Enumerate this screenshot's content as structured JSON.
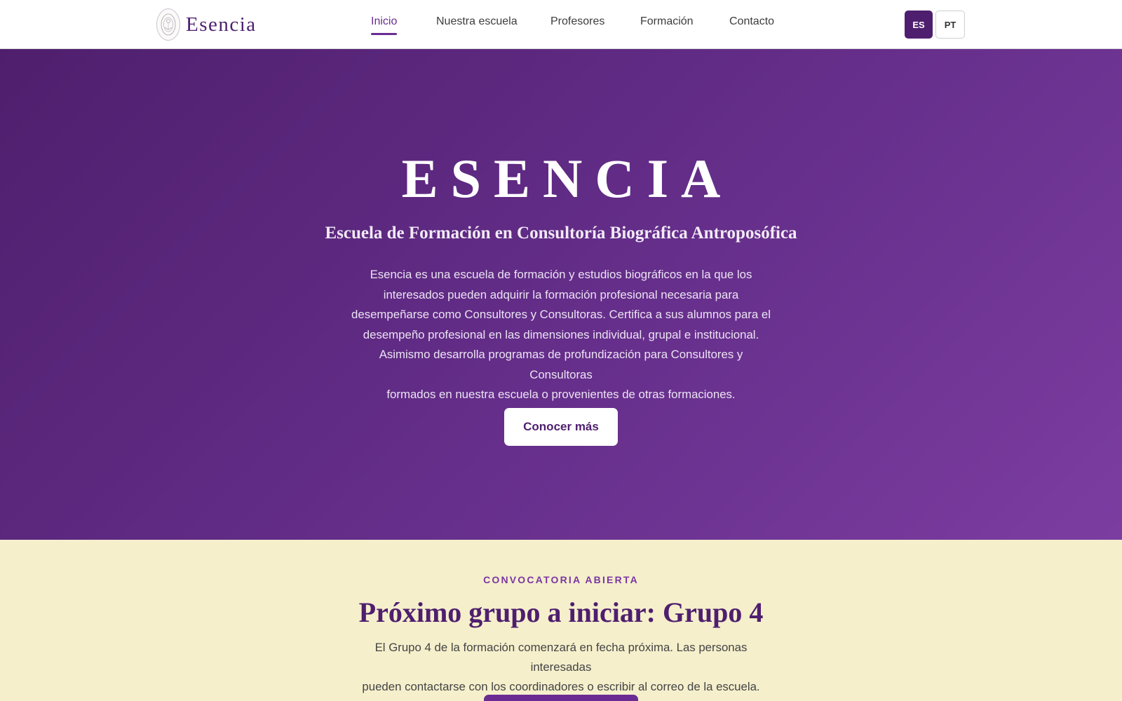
{
  "header": {
    "brand_name": "Esencia",
    "logo_icon": "ornamental-seal-icon",
    "nav": [
      {
        "label": "Inicio",
        "active": true
      },
      {
        "label": "Nuestra escuela",
        "active": false
      },
      {
        "label": "Profesores",
        "active": false
      },
      {
        "label": "Formación",
        "active": false
      },
      {
        "label": "Contacto",
        "active": false
      }
    ],
    "languages": [
      {
        "label": "ES",
        "selected": true
      },
      {
        "label": "PT",
        "selected": false
      }
    ]
  },
  "hero": {
    "title": "ESENCIA",
    "subtitle": "Escuela de Formación en Consultoría Biográfica Antroposófica",
    "description_lines": [
      "Esencia es una escuela de formación y estudios biográficos en la que los",
      "interesados pueden adquirir la formación profesional necesaria para",
      "desempeñarse como Consultores y Consultoras. Certifica a sus alumnos para el",
      "desempeño profesional en las dimensiones individual, grupal e institucional.",
      "Asimismo desarrolla programas de profundización para Consultores y Consultoras",
      "formados en nuestra escuela o provenientes de otras formaciones."
    ],
    "cta_label": "Conocer más"
  },
  "convocatoria": {
    "eyebrow": "CONVOCATORIA ABIERTA",
    "title": "Próximo grupo a iniciar: Grupo 4",
    "description_lines": [
      "El Grupo 4 de la formación comenzará en fecha próxima. Las personas interesadas",
      "pueden contactarse con los coordinadores o escribir al correo de la escuela."
    ]
  },
  "colors": {
    "primary": "#4e1f6e",
    "accent": "#6a2c93",
    "hero_gradient_start": "#4f1f6d",
    "hero_gradient_end": "#7c3da1",
    "section_background": "#f5efcc"
  }
}
